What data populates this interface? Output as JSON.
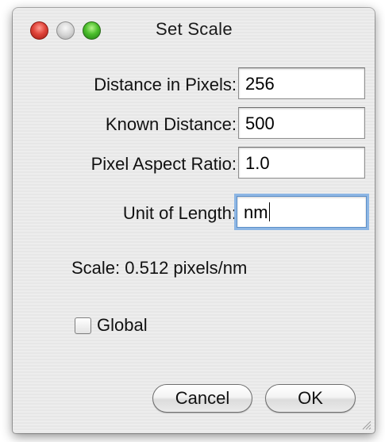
{
  "window": {
    "title": "Set Scale"
  },
  "form": {
    "distance_in_pixels": {
      "label": "Distance in Pixels:",
      "value": "256"
    },
    "known_distance": {
      "label": "Known Distance:",
      "value": "500"
    },
    "pixel_aspect_ratio": {
      "label": "Pixel Aspect Ratio:",
      "value": "1.0"
    },
    "unit_of_length": {
      "label": "Unit of Length:",
      "value": "nm"
    }
  },
  "scale": {
    "text": "Scale: 0.512 pixels/nm"
  },
  "global": {
    "label": "Global",
    "checked": false
  },
  "buttons": {
    "cancel": "Cancel",
    "ok": "OK"
  }
}
